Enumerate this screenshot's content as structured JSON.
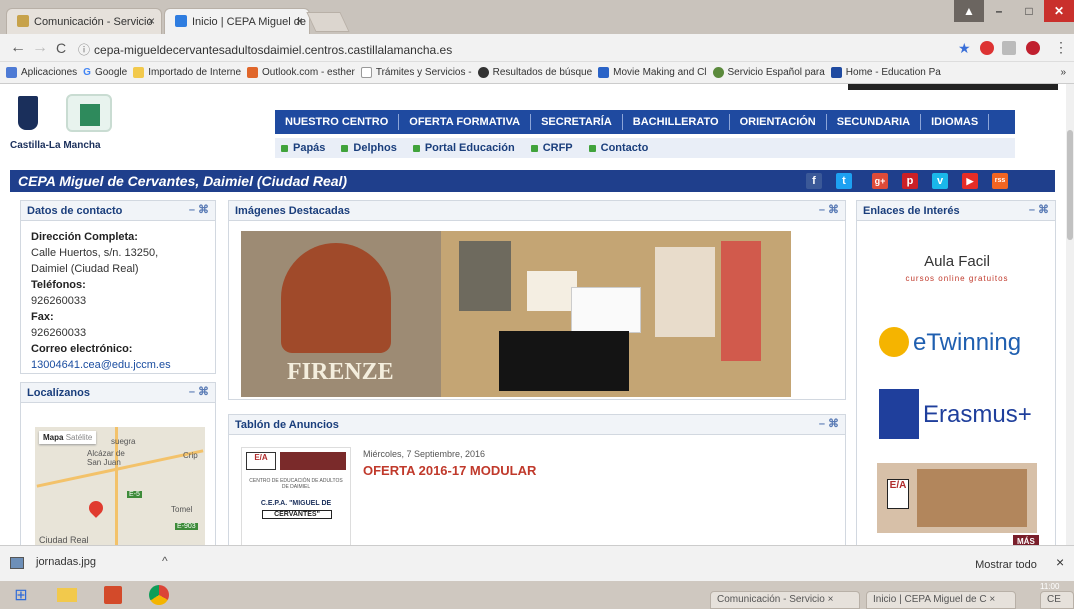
{
  "browser": {
    "tabs": [
      {
        "title": "Comunicación - Servicio",
        "close": "×"
      },
      {
        "title": "Inicio | CEPA Miguel de C",
        "close": "×"
      }
    ],
    "url": "cepa-migueldecervantesadultosdaimiel.centros.castillalamancha.es",
    "bookmarks": [
      "Aplicaciones",
      "Google",
      "Importado de Interne",
      "Outlook.com - esther",
      "Trámites y Servicios -",
      "Resultados de búsque",
      "Movie Making and Cl",
      "Servicio Español para",
      "Home - Education Pa"
    ],
    "bookmarks_more": "»"
  },
  "site": {
    "logo_text": "Castilla-La Mancha",
    "main_menu": [
      "NUESTRO CENTRO",
      "OFERTA FORMATIVA",
      "SECRETARÍA",
      "BACHILLERATO",
      "ORIENTACIÓN",
      "SECUNDARIA",
      "IDIOMAS"
    ],
    "sub_menu": [
      "Papás",
      "Delphos",
      "Portal Educación",
      "CRFP",
      "Contacto"
    ],
    "title": "CEPA Miguel de Cervantes, Daimiel (Ciudad Real)",
    "social": [
      "f",
      "t",
      "g+",
      "p",
      "v",
      "▶",
      "rss"
    ]
  },
  "contact": {
    "heading": "Datos de contacto",
    "address_label": "Dirección Completa:",
    "address_1": "Calle Huertos, s/n. 13250,",
    "address_2": "Daimiel (Ciudad Real)",
    "phone_label": "Teléfonos:",
    "phone": "926260033",
    "fax_label": "Fax:",
    "fax": "926260033",
    "email_label": "Correo electrónico:",
    "email": "13004641.cea@edu.jccm.es"
  },
  "map": {
    "heading": "Localízanos",
    "tabs": [
      "Mapa",
      "Satélite"
    ],
    "places": [
      "Alcázar de San Juan",
      "Tomel",
      "Ciudad Real",
      "Crip",
      "suegra"
    ],
    "road_1": "E-5",
    "road_2": "E-903"
  },
  "featured": {
    "heading": "Imágenes Destacadas",
    "poster_word": "FIRENZE"
  },
  "notices": {
    "heading": "Tablón de Anuncios",
    "date": "Miércoles, 7 Septiembre, 2016",
    "title": "OFERTA 2016-17 MODULAR",
    "thumb_line1": "C.E.P.A. \"MIGUEL DE",
    "thumb_line2": "CERVANTES\"",
    "thumb_small": "CENTRO DE EDUCACIÓN DE ADULTOS DE DAIMIEL"
  },
  "links": {
    "heading": "Enlaces de Interés",
    "aula_title": "Aula Facil",
    "aula_sub": "cursos online gratuitos",
    "etwinning": "eTwinning",
    "erasmus": "Erasmus+",
    "more": "MÁS"
  },
  "panel_controls": "– ⌘",
  "download": {
    "file": "jornadas.jpg",
    "show_all": "Mostrar todo",
    "close": "×"
  },
  "taskbar": {
    "time": "11:00",
    "tabs": [
      "Comunicación - Servicio",
      "Inicio | CEPA Miguel de C",
      "CE"
    ]
  }
}
